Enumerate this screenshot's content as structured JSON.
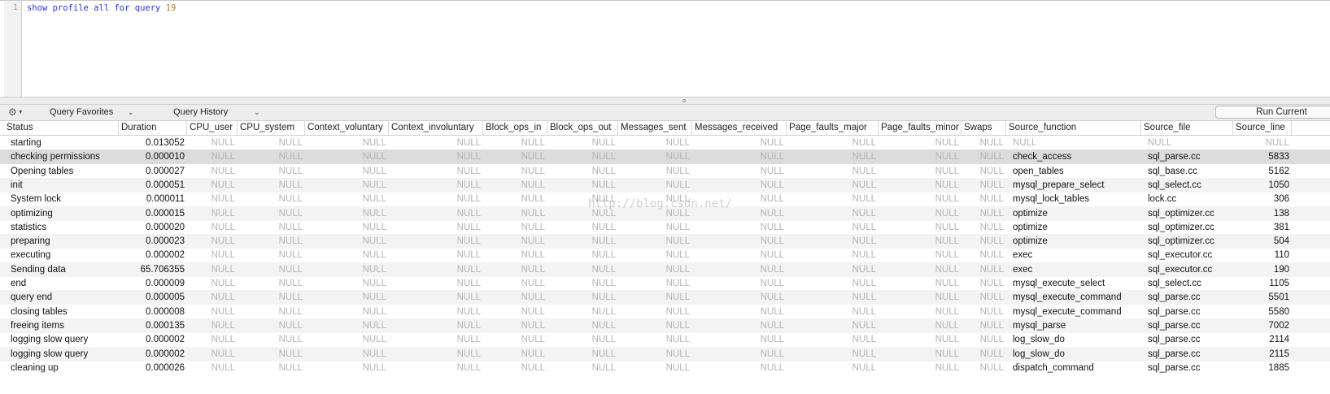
{
  "editor": {
    "line_number": "1",
    "query_keywords": "show profile all for query",
    "query_number": "19"
  },
  "toolbar": {
    "settings_icon": "gear-icon",
    "query_favorites": "Query Favorites",
    "query_history": "Query History",
    "run_current": "Run Current"
  },
  "table": {
    "columns": [
      "Status",
      "Duration",
      "CPU_user",
      "CPU_system",
      "Context_voluntary",
      "Context_involuntary",
      "Block_ops_in",
      "Block_ops_out",
      "Messages_sent",
      "Messages_received",
      "Page_faults_major",
      "Page_faults_minor",
      "Swaps",
      "Source_function",
      "Source_file",
      "Source_line"
    ],
    "selected_row": 1,
    "rows": [
      [
        "starting",
        "0.013052",
        "NULL",
        "NULL",
        "NULL",
        "NULL",
        "NULL",
        "NULL",
        "NULL",
        "NULL",
        "NULL",
        "NULL",
        "NULL",
        "NULL",
        "NULL",
        "NULL"
      ],
      [
        "checking permissions",
        "0.000010",
        "NULL",
        "NULL",
        "NULL",
        "NULL",
        "NULL",
        "NULL",
        "NULL",
        "NULL",
        "NULL",
        "NULL",
        "NULL",
        "check_access",
        "sql_parse.cc",
        "5833"
      ],
      [
        "Opening tables",
        "0.000027",
        "NULL",
        "NULL",
        "NULL",
        "NULL",
        "NULL",
        "NULL",
        "NULL",
        "NULL",
        "NULL",
        "NULL",
        "NULL",
        "open_tables",
        "sql_base.cc",
        "5162"
      ],
      [
        "init",
        "0.000051",
        "NULL",
        "NULL",
        "NULL",
        "NULL",
        "NULL",
        "NULL",
        "NULL",
        "NULL",
        "NULL",
        "NULL",
        "NULL",
        "mysql_prepare_select",
        "sql_select.cc",
        "1050"
      ],
      [
        "System lock",
        "0.000011",
        "NULL",
        "NULL",
        "NULL",
        "NULL",
        "NULL",
        "NULL",
        "NULL",
        "NULL",
        "NULL",
        "NULL",
        "NULL",
        "mysql_lock_tables",
        "lock.cc",
        "306"
      ],
      [
        "optimizing",
        "0.000015",
        "NULL",
        "NULL",
        "NULL",
        "NULL",
        "NULL",
        "NULL",
        "NULL",
        "NULL",
        "NULL",
        "NULL",
        "NULL",
        "optimize",
        "sql_optimizer.cc",
        "138"
      ],
      [
        "statistics",
        "0.000020",
        "NULL",
        "NULL",
        "NULL",
        "NULL",
        "NULL",
        "NULL",
        "NULL",
        "NULL",
        "NULL",
        "NULL",
        "NULL",
        "optimize",
        "sql_optimizer.cc",
        "381"
      ],
      [
        "preparing",
        "0.000023",
        "NULL",
        "NULL",
        "NULL",
        "NULL",
        "NULL",
        "NULL",
        "NULL",
        "NULL",
        "NULL",
        "NULL",
        "NULL",
        "optimize",
        "sql_optimizer.cc",
        "504"
      ],
      [
        "executing",
        "0.000002",
        "NULL",
        "NULL",
        "NULL",
        "NULL",
        "NULL",
        "NULL",
        "NULL",
        "NULL",
        "NULL",
        "NULL",
        "NULL",
        "exec",
        "sql_executor.cc",
        "110"
      ],
      [
        "Sending data",
        "65.706355",
        "NULL",
        "NULL",
        "NULL",
        "NULL",
        "NULL",
        "NULL",
        "NULL",
        "NULL",
        "NULL",
        "NULL",
        "NULL",
        "exec",
        "sql_executor.cc",
        "190"
      ],
      [
        "end",
        "0.000009",
        "NULL",
        "NULL",
        "NULL",
        "NULL",
        "NULL",
        "NULL",
        "NULL",
        "NULL",
        "NULL",
        "NULL",
        "NULL",
        "mysql_execute_select",
        "sql_select.cc",
        "1105"
      ],
      [
        "query end",
        "0.000005",
        "NULL",
        "NULL",
        "NULL",
        "NULL",
        "NULL",
        "NULL",
        "NULL",
        "NULL",
        "NULL",
        "NULL",
        "NULL",
        "mysql_execute_command",
        "sql_parse.cc",
        "5501"
      ],
      [
        "closing tables",
        "0.000008",
        "NULL",
        "NULL",
        "NULL",
        "NULL",
        "NULL",
        "NULL",
        "NULL",
        "NULL",
        "NULL",
        "NULL",
        "NULL",
        "mysql_execute_command",
        "sql_parse.cc",
        "5580"
      ],
      [
        "freeing items",
        "0.000135",
        "NULL",
        "NULL",
        "NULL",
        "NULL",
        "NULL",
        "NULL",
        "NULL",
        "NULL",
        "NULL",
        "NULL",
        "NULL",
        "mysql_parse",
        "sql_parse.cc",
        "7002"
      ],
      [
        "logging slow query",
        "0.000002",
        "NULL",
        "NULL",
        "NULL",
        "NULL",
        "NULL",
        "NULL",
        "NULL",
        "NULL",
        "NULL",
        "NULL",
        "NULL",
        "log_slow_do",
        "sql_parse.cc",
        "2114"
      ],
      [
        "logging slow query",
        "0.000002",
        "NULL",
        "NULL",
        "NULL",
        "NULL",
        "NULL",
        "NULL",
        "NULL",
        "NULL",
        "NULL",
        "NULL",
        "NULL",
        "log_slow_do",
        "sql_parse.cc",
        "2115"
      ],
      [
        "cleaning up",
        "0.000026",
        "NULL",
        "NULL",
        "NULL",
        "NULL",
        "NULL",
        "NULL",
        "NULL",
        "NULL",
        "NULL",
        "NULL",
        "NULL",
        "dispatch_command",
        "sql_parse.cc",
        "1885"
      ]
    ]
  },
  "watermark": "http://blog.csdn.net/"
}
